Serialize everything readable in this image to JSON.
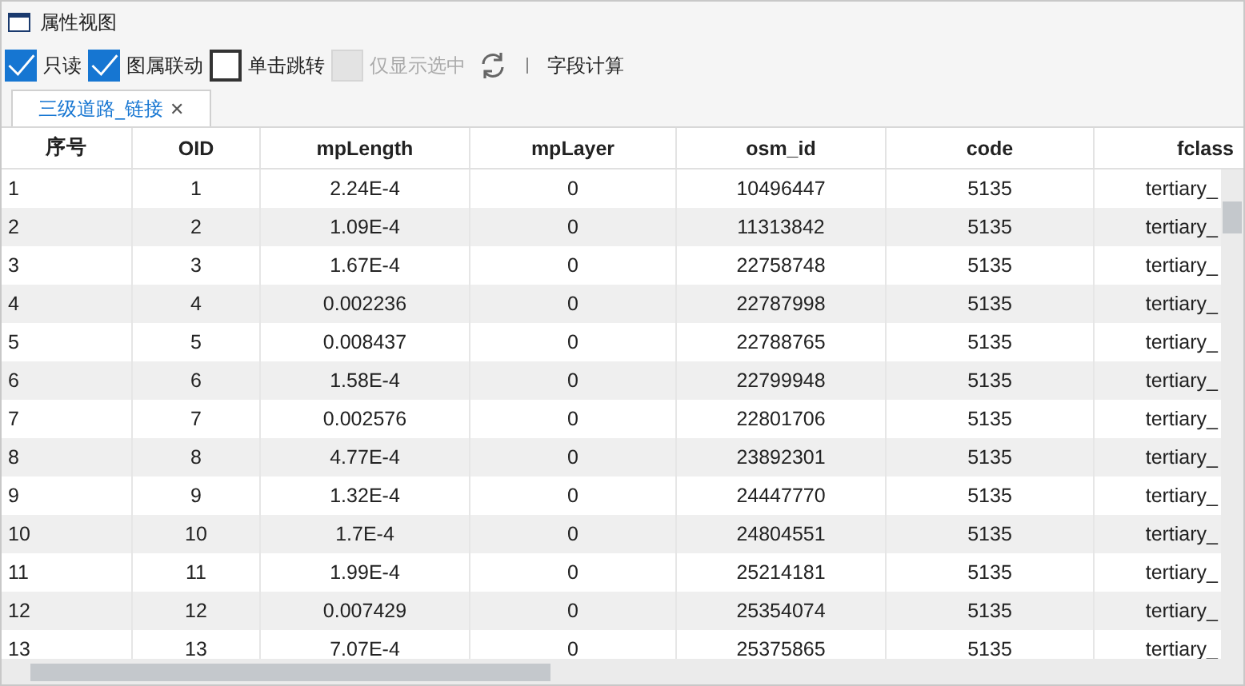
{
  "window": {
    "title": "属性视图"
  },
  "toolbar": {
    "options": [
      {
        "label": "只读",
        "checked": true,
        "disabled": false
      },
      {
        "label": "图属联动",
        "checked": true,
        "disabled": false
      },
      {
        "label": "单击跳转",
        "checked": false,
        "disabled": false
      },
      {
        "label": "仅显示选中",
        "checked": false,
        "disabled": true
      }
    ],
    "field_calc": "字段计算"
  },
  "tabs": [
    {
      "label": "三级道路_链接",
      "selected": true,
      "close": "✕"
    }
  ],
  "table": {
    "columns": [
      "序号",
      "OID",
      "mpLength",
      "mpLayer",
      "osm_id",
      "code",
      "fclass"
    ],
    "rows": [
      [
        "1",
        "1",
        "2.24E-4",
        "0",
        "10496447",
        "5135",
        "tertiary_"
      ],
      [
        "2",
        "2",
        "1.09E-4",
        "0",
        "11313842",
        "5135",
        "tertiary_"
      ],
      [
        "3",
        "3",
        "1.67E-4",
        "0",
        "22758748",
        "5135",
        "tertiary_"
      ],
      [
        "4",
        "4",
        "0.002236",
        "0",
        "22787998",
        "5135",
        "tertiary_"
      ],
      [
        "5",
        "5",
        "0.008437",
        "0",
        "22788765",
        "5135",
        "tertiary_"
      ],
      [
        "6",
        "6",
        "1.58E-4",
        "0",
        "22799948",
        "5135",
        "tertiary_"
      ],
      [
        "7",
        "7",
        "0.002576",
        "0",
        "22801706",
        "5135",
        "tertiary_"
      ],
      [
        "8",
        "8",
        "4.77E-4",
        "0",
        "23892301",
        "5135",
        "tertiary_"
      ],
      [
        "9",
        "9",
        "1.32E-4",
        "0",
        "24447770",
        "5135",
        "tertiary_"
      ],
      [
        "10",
        "10",
        "1.7E-4",
        "0",
        "24804551",
        "5135",
        "tertiary_"
      ],
      [
        "11",
        "11",
        "1.99E-4",
        "0",
        "25214181",
        "5135",
        "tertiary_"
      ],
      [
        "12",
        "12",
        "0.007429",
        "0",
        "25354074",
        "5135",
        "tertiary_"
      ],
      [
        "13",
        "13",
        "7.07E-4",
        "0",
        "25375865",
        "5135",
        "tertiary_"
      ]
    ]
  }
}
